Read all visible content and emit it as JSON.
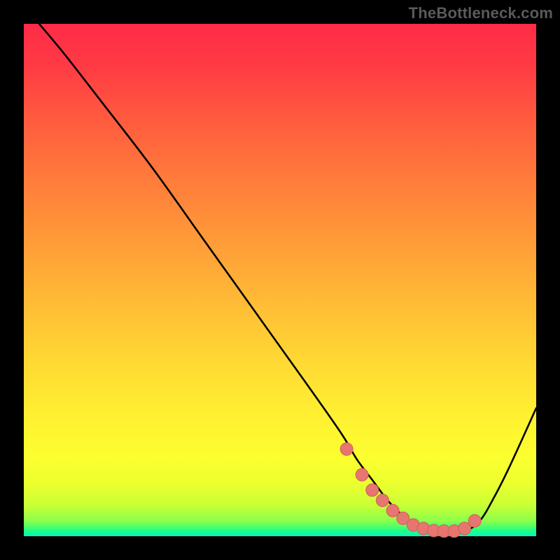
{
  "watermark": "TheBottleneck.com",
  "colors": {
    "page_bg": "#000000",
    "curve": "#000000",
    "marker_fill": "#e6766f",
    "marker_stroke": "#cf5f58"
  },
  "chart_data": {
    "type": "line",
    "title": "",
    "xlabel": "",
    "ylabel": "",
    "xlim": [
      0,
      100
    ],
    "ylim": [
      0,
      100
    ],
    "grid": false,
    "series": [
      {
        "name": "bottleneck-curve",
        "x": [
          3,
          8,
          15,
          25,
          35,
          45,
          55,
          62,
          65,
          68,
          71,
          74,
          77,
          80,
          83,
          86,
          89,
          92,
          95,
          100
        ],
        "values": [
          100,
          94,
          85,
          72,
          58,
          44,
          30,
          20,
          15,
          11,
          7,
          4,
          2,
          1,
          0.8,
          1,
          3,
          8,
          14,
          25
        ]
      }
    ],
    "markers": {
      "name": "highlight-points",
      "x": [
        63,
        66,
        68,
        70,
        72,
        74,
        76,
        78,
        80,
        82,
        84,
        86,
        88
      ],
      "values": [
        17,
        12,
        9,
        7,
        5,
        3.5,
        2.2,
        1.5,
        1.1,
        1,
        1,
        1.5,
        3
      ]
    }
  }
}
